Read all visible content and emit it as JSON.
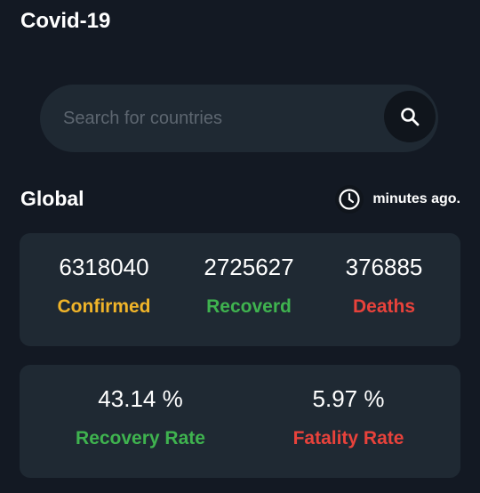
{
  "header": {
    "title": "Covid-19"
  },
  "search": {
    "placeholder": "Search for countries",
    "value": ""
  },
  "global": {
    "title": "Global",
    "updated": "minutes ago."
  },
  "stats": [
    {
      "value": "6318040",
      "label": "Confirmed",
      "color": "#f0b429"
    },
    {
      "value": "2725627",
      "label": "Recoverd",
      "color": "#3fb34f"
    },
    {
      "value": "376885",
      "label": "Deaths",
      "color": "#e8423b"
    }
  ],
  "rates": [
    {
      "value": "43.14 %",
      "label": "Recovery Rate",
      "color": "#3fb34f"
    },
    {
      "value": "5.97 %",
      "label": "Fatality Rate",
      "color": "#e8423b"
    }
  ],
  "icons": {
    "search": "search-icon",
    "clock": "clock-icon"
  },
  "colors": {
    "background": "#131923",
    "card": "#1f2933",
    "icon_bg": "#10151c"
  }
}
